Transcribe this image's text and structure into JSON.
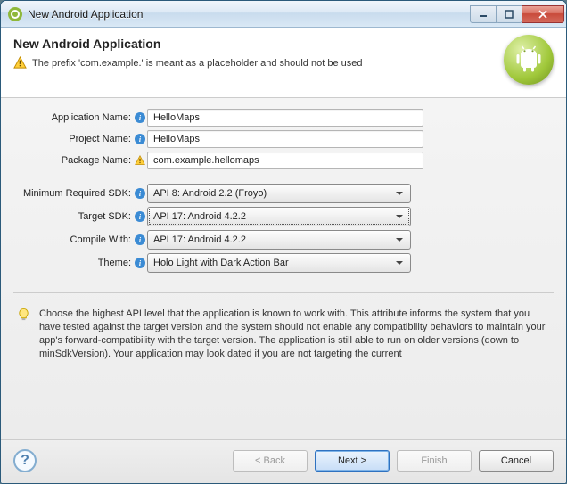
{
  "window": {
    "title": "New Android Application"
  },
  "header": {
    "heading": "New Android Application",
    "warning": "The prefix 'com.example.' is meant as a placeholder and should not be used"
  },
  "form": {
    "text_fields": {
      "application_name": {
        "label": "Application Name:",
        "value": "HelloMaps",
        "indicator": "info"
      },
      "project_name": {
        "label": "Project Name:",
        "value": "HelloMaps",
        "indicator": "info"
      },
      "package_name": {
        "label": "Package Name:",
        "value": "com.example.hellomaps",
        "indicator": "warn"
      }
    },
    "selects": {
      "min_sdk": {
        "label": "Minimum Required SDK:",
        "value": "API 8: Android 2.2 (Froyo)"
      },
      "target_sdk": {
        "label": "Target SDK:",
        "value": "API 17: Android 4.2.2"
      },
      "compile_with": {
        "label": "Compile With:",
        "value": "API 17: Android 4.2.2"
      },
      "theme": {
        "label": "Theme:",
        "value": "Holo Light with Dark Action Bar"
      }
    }
  },
  "tip": "Choose the highest API level that the application is known to work with. This attribute informs the system that you have tested against the target version and the system should not enable any compatibility behaviors to maintain your app's forward-compatibility with the target version. The application is still able to run on older versions (down to minSdkVersion). Your application may look dated if you are not targeting the current",
  "footer": {
    "back": "< Back",
    "next": "Next >",
    "finish": "Finish",
    "cancel": "Cancel"
  }
}
